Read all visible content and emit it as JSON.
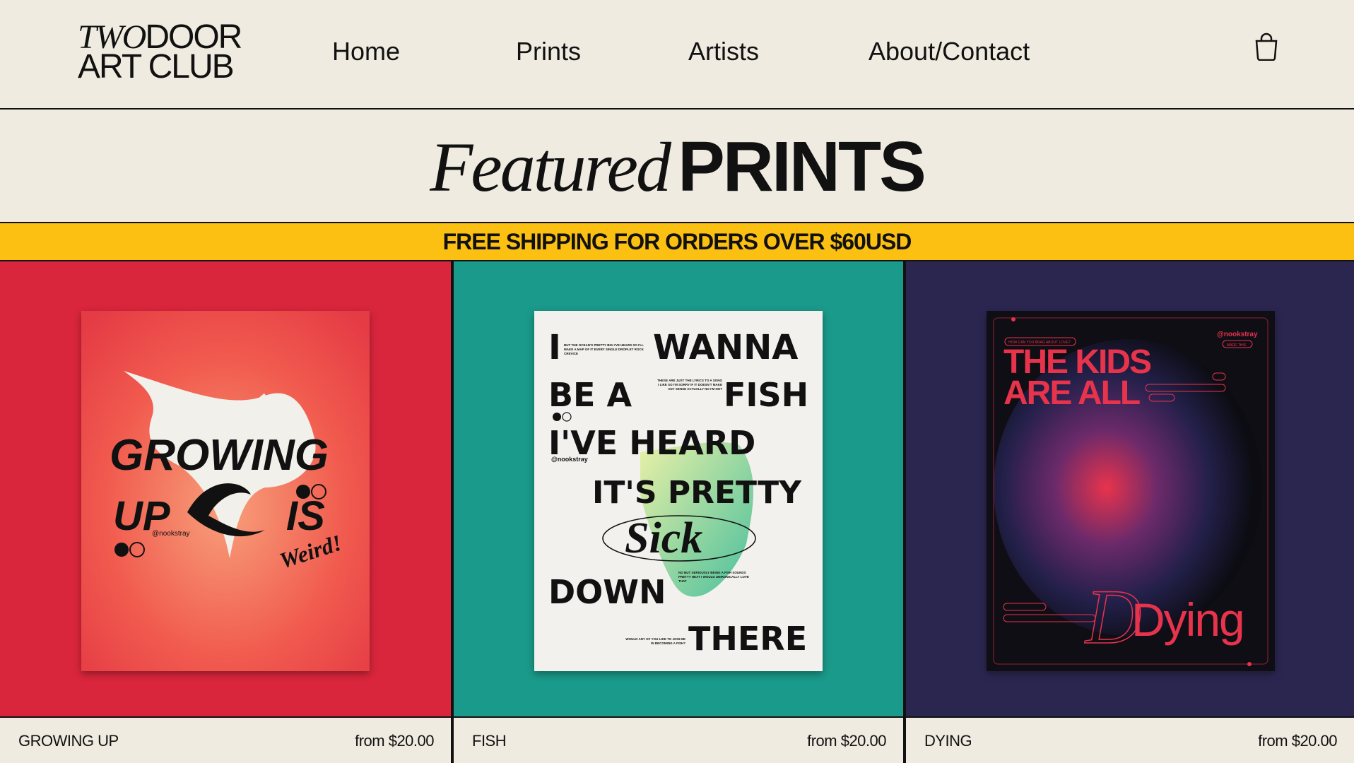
{
  "header": {
    "logo": {
      "line1_italic": "TWO",
      "line1_rest": "DOOR",
      "line2": "ART CLUB"
    },
    "nav": [
      "Home",
      "Prints",
      "Artists",
      "About/Contact"
    ],
    "cart_icon": "shopping-bag-icon"
  },
  "featured": {
    "italic": "Featured",
    "bold": "PRINTS"
  },
  "banner": "FREE SHIPPING FOR ORDERS OVER $60USD",
  "colors": {
    "background": "#efebe0",
    "banner": "#fbc011",
    "card1": "#d9263c",
    "card2": "#1a9a8a",
    "card3": "#2b2650"
  },
  "products": [
    {
      "name": "GROWING UP",
      "price": "from $20.00",
      "poster": {
        "line1": "GROWING",
        "line2a": "UP",
        "line2b": "IS",
        "script": "Weird!",
        "handle": "@nookstray"
      }
    },
    {
      "name": "FISH",
      "price": "from $20.00",
      "poster": {
        "words": [
          "I",
          "WANNA",
          "BE A",
          "FISH",
          "I'VE HEARD",
          "IT'S PRETTY",
          "Sick",
          "DOWN",
          "THERE"
        ],
        "handle": "@nookstray",
        "note1": "BUT THE OCEAN'S PRETTY BIG I'VE HEARD SO I'LL MAKE A MAP OF IT EVERY SINGLE DROPLET ROCK CREVICE",
        "note2": "THESE ARE JUST THE LYRICS TO A SONG I LIKE SO I'M SORRY IF IT DOESN'T MAKE ANY SENSE ACTUALLY NO I'M NOT",
        "note3": "NO BUT SERIOUSLY BEING A FISH SOUNDS PRETTY NEAT I WOULD UNIRONICALLY LOVE THAT",
        "note4": "WOULD ANY OF YOU LIKE TO JOIN ME IN BECOMING A FISH?"
      }
    },
    {
      "name": "DYING",
      "price": "from $20.00",
      "poster": {
        "line1": "THE KIDS",
        "line2": "ARE ALL",
        "script": "Dying",
        "handle": "@nookstray",
        "tag1": "HOW CAN YOU BRAG ABOUT LOVE?",
        "tag2": "MADE THIS"
      }
    }
  ]
}
